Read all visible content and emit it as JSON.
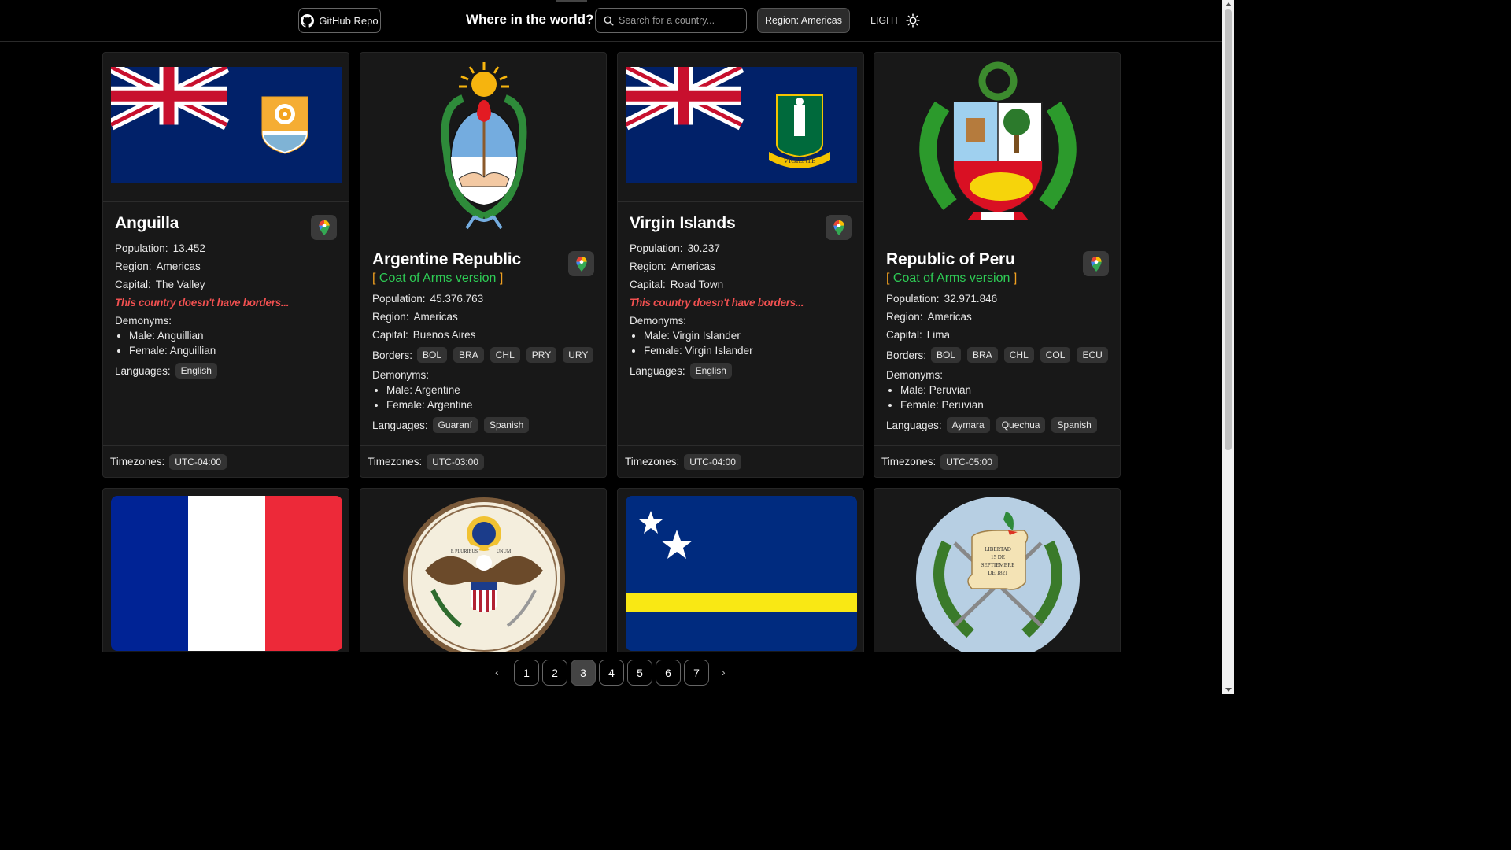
{
  "header": {
    "github_label": "GitHub Repo",
    "title": "Where in the world?",
    "search_placeholder": "Search for a country...",
    "region_label": "Region: Americas",
    "theme_label": "LIGHT",
    "theme_icon": "sun-icon"
  },
  "labels": {
    "population": "Population:",
    "region": "Region:",
    "capital": "Capital:",
    "borders": "Borders:",
    "demonyms": "Demonyms:",
    "languages": "Languages:",
    "timezones": "Timezones:",
    "no_borders": "This country doesn't have borders...",
    "coa_open": "[",
    "coa_text": "Coat of Arms version",
    "coa_close": "]"
  },
  "cards": [
    {
      "name": "Anguilla",
      "population": "13.452",
      "region": "Americas",
      "capital": "The Valley",
      "male": "Male: Anguillian",
      "female": "Female: Anguillian",
      "languages": [
        "English"
      ],
      "timezone": "UTC-04:00"
    },
    {
      "name": "Argentine Republic",
      "population": "45.376.763",
      "region": "Americas",
      "capital": "Buenos Aires",
      "borders": [
        "BOL",
        "BRA",
        "CHL",
        "PRY",
        "URY"
      ],
      "male": "Male: Argentine",
      "female": "Female: Argentine",
      "languages": [
        "Guaraní",
        "Spanish"
      ],
      "timezone": "UTC-03:00"
    },
    {
      "name": "Virgin Islands",
      "population": "30.237",
      "region": "Americas",
      "capital": "Road Town",
      "male": "Male: Virgin Islander",
      "female": "Female: Virgin Islander",
      "languages": [
        "English"
      ],
      "timezone": "UTC-04:00"
    },
    {
      "name": "Republic of Peru",
      "population": "32.971.846",
      "region": "Americas",
      "capital": "Lima",
      "borders": [
        "BOL",
        "BRA",
        "CHL",
        "COL",
        "ECU"
      ],
      "male": "Male: Peruvian",
      "female": "Female: Peruvian",
      "languages": [
        "Aymara",
        "Quechua",
        "Spanish"
      ],
      "timezone": "UTC-05:00"
    }
  ],
  "guatemala_scroll": [
    "LIBERTAD",
    "15 DE",
    "SEPTIEMBRE",
    "DE 1821"
  ],
  "usa_seal_motto": [
    "E PLURIBUS",
    "UNUM"
  ],
  "bvi_motto": "VIGILATE",
  "pagination": {
    "prev": "‹",
    "next": "›",
    "pages": [
      "1",
      "2",
      "3",
      "4",
      "5",
      "6",
      "7"
    ],
    "active_page": "3"
  },
  "colors": {
    "accent_green": "#2ecc55",
    "accent_orange": "#f0a020",
    "warning_red": "#f05050"
  }
}
